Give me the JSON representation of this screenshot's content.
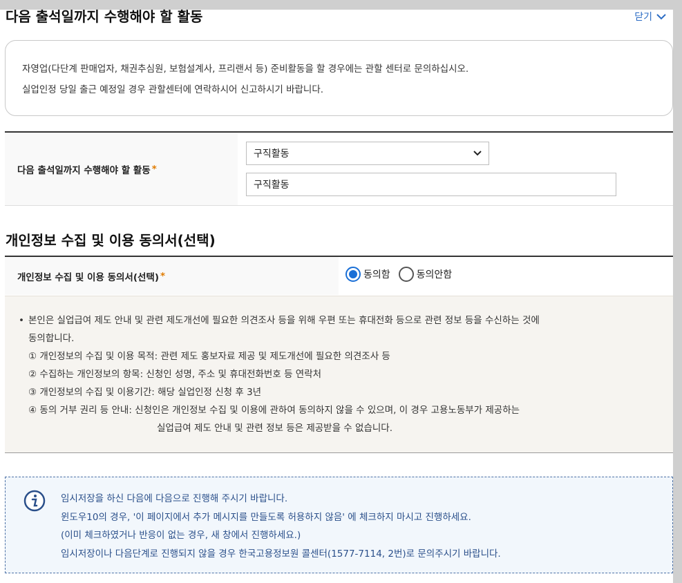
{
  "section1": {
    "title": "다음 출석일까지 수행해야 할 활동",
    "close_label": "닫기"
  },
  "notice": {
    "line1": "자영업(다단계 판매업자, 채권추심원, 보험설계사, 프리랜서 등) 준비활동을 할 경우에는 관할 센터로 문의하십시오.",
    "line2": "실업인정 당일 출근 예정일 경우 관할센터에 연락하시어 신고하시기 바랍니다."
  },
  "activity": {
    "label": "다음 출석일까지 수행해야 할 활동",
    "required_mark": "*",
    "select_value": "구직활동",
    "input_value": "구직활동"
  },
  "section2": {
    "title": "개인정보 수집 및 이용 동의서(선택)"
  },
  "consent": {
    "label": "개인정보 수집 및 이용 동의서(선택)",
    "required_mark": "*",
    "options": [
      "동의함",
      "동의안함"
    ],
    "selected": "동의함",
    "bullet": "•",
    "text_line1": "본인은 실업급여 제도 안내 및 관련 제도개선에 필요한 의견조사 등을 위해 우편 또는 휴대전화 등으로 관련 정보 등을 수신하는 것에",
    "text_line2": "동의합니다.",
    "item1": "① 개인정보의 수집 및 이용 목적: 관련 제도 홍보자료 제공 및 제도개선에 필요한 의견조사 등",
    "item2": "② 수집하는 개인정보의 항목: 신청인 성명, 주소 및 휴대전화번호 등 연락처",
    "item3": "③ 개인정보의 수집 및 이용기간: 해당 실업인정 신청 후 3년",
    "item4": "④ 동의 거부 권리 등 안내: 신청인은 개인정보 수집 및 이용에 관하여 동의하지 않을 수 있으며, 이 경우 고용노동부가 제공하는",
    "item4_cont": "실업급여 제도 안내 및 관련 정보 등은 제공받을 수 없습니다."
  },
  "info": {
    "line1": "임시저장을 하신 다음에 다음으로 진행해 주시기 바랍니다.",
    "line2": "윈도우10의 경우, '이 페이지에서 추가 메시지를 만들도록 허용하지 않음' 에 체크하지 마시고 진행하세요.",
    "line3": "(이미 체크하였거나 반응이 없는 경우, 새 창에서 진행하세요.)",
    "line4": "임시저장이나 다음단계로 진행되지 않을 경우 한국고용정보원 콜센터(1577-7114, 2번)로 문의주시기 바랍니다."
  },
  "colors": {
    "accent": "#1a6fd6",
    "required": "#e07b00",
    "info_text": "#2a4f8a"
  }
}
